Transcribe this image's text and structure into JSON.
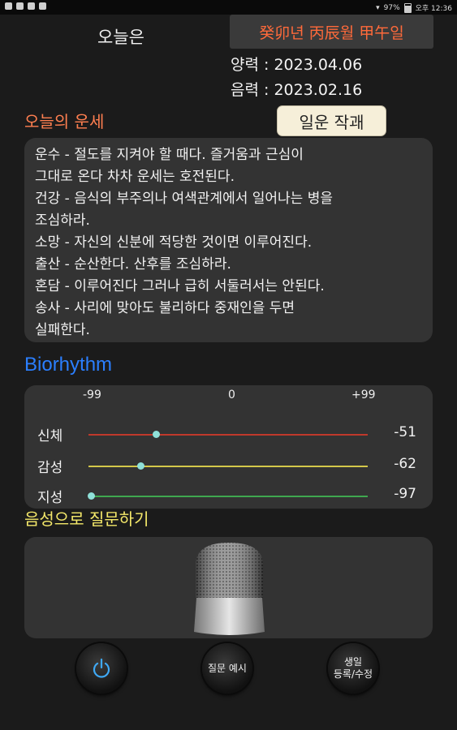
{
  "status_bar": {
    "battery": "97%",
    "time": "오후 12:36"
  },
  "header": {
    "today_label": "오늘은",
    "ganji": "癸卯년 丙辰월 甲午일",
    "solar_date": "양력 : 2023.04.06",
    "lunar_date": "음력 : 2023.02.16"
  },
  "fortune": {
    "title": "오늘의 운세",
    "button_label": "일운 작괘",
    "text": "운수 - 절도를 지켜야 할 때다. 즐거움과 근심이\n그대로 온다 차차 운세는 호전된다.\n건강 - 음식의 부주의나 여색관계에서 일어나는 병을\n조심하라.\n소망 - 자신의 신분에 적당한 것이면 이루어진다.\n출산 - 순산한다. 산후를 조심하라.\n혼담 - 이루어진다 그러나 급히 서둘러서는 안된다.\n송사 - 사리에 맞아도 불리하다 중재인을 두면\n실패한다."
  },
  "biorhythm": {
    "title": "Biorhythm",
    "scale": {
      "min": "-99",
      "zero": "0",
      "max": "+99"
    },
    "rows": [
      {
        "label": "신체",
        "value": "-51",
        "color": "#c0392b"
      },
      {
        "label": "감성",
        "value": "-62",
        "color": "#d4c84a"
      },
      {
        "label": "지성",
        "value": "-97",
        "color": "#3fa84f"
      }
    ]
  },
  "voice": {
    "title": "음성으로 질문하기",
    "power_icon": "power-icon",
    "mic_icon": "microphone-icon",
    "example_label": "질문 예시",
    "birth_label_1": "생일",
    "birth_label_2": "등록/수정"
  }
}
